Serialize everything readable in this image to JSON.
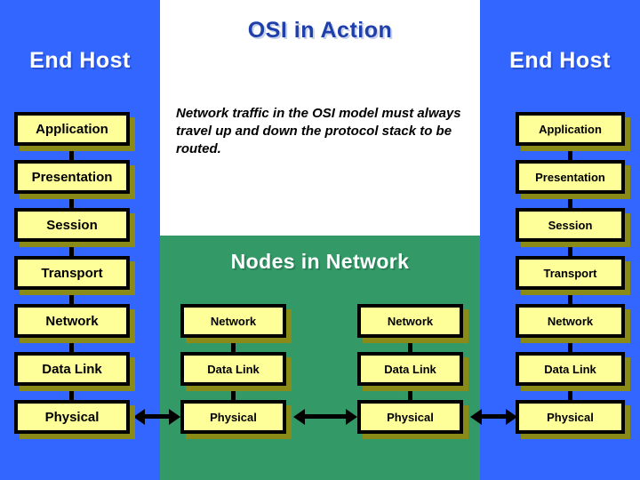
{
  "slide": {
    "title": "OSI in Action",
    "note": "Network traffic in the OSI model must always travel up and down the protocol stack to be routed.",
    "nodes_title": "Nodes in Network",
    "end_host_left": "End Host",
    "end_host_right": "End Host"
  },
  "colors": {
    "panel_blue": "#3366FF",
    "panel_green": "#339966",
    "box_fill": "#FFFF99",
    "box_border": "#000000",
    "box_shadow": "#8A8A18",
    "title_blue": "#1F3FAA",
    "heading_white": "#FFFFFF"
  },
  "stacks": {
    "end_host_left": {
      "label": "End Host",
      "layers": [
        "Application",
        "Presentation",
        "Session",
        "Transport",
        "Network",
        "Data Link",
        "Physical"
      ]
    },
    "node_1": {
      "layers": [
        "Network",
        "Data Link",
        "Physical"
      ]
    },
    "node_2": {
      "layers": [
        "Network",
        "Data Link",
        "Physical"
      ]
    },
    "end_host_right": {
      "label": "End Host",
      "layers": [
        "Application",
        "Presentation",
        "Session",
        "Transport",
        "Network",
        "Data Link",
        "Physical"
      ]
    }
  }
}
